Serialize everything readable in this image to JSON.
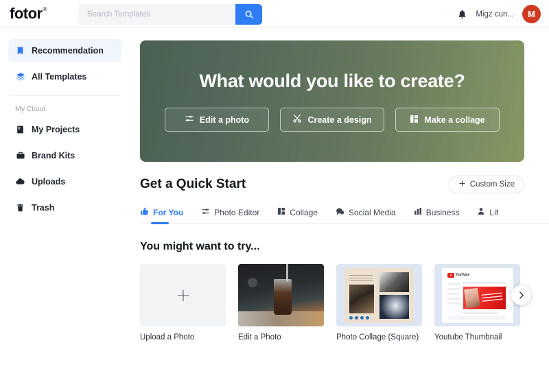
{
  "header": {
    "logo": "fotor",
    "logo_sup": "®",
    "search": {
      "value": "",
      "placeholder": "Search Templates",
      "icon": "search-icon"
    },
    "notification_icon": "bell-icon",
    "username": "Migz cun...",
    "avatar_initial": "M",
    "avatar_color": "#cf3a20",
    "accent_color": "#2f7df4"
  },
  "sidebar": {
    "items": [
      {
        "label": "Recommendation",
        "icon": "bookmark-icon",
        "active": true
      },
      {
        "label": "All Templates",
        "icon": "layers-icon",
        "active": false
      }
    ],
    "section_label": "My Cloud",
    "cloud_items": [
      {
        "label": "My Projects",
        "icon": "document-icon"
      },
      {
        "label": "Brand Kits",
        "icon": "briefcase-icon"
      },
      {
        "label": "Uploads",
        "icon": "cloud-upload-icon"
      },
      {
        "label": "Trash",
        "icon": "trash-icon"
      }
    ]
  },
  "hero": {
    "title": "What would you like to create?",
    "gradient_from": "#4a6152",
    "gradient_to": "#879661",
    "buttons": [
      {
        "label": "Edit a photo",
        "icon": "sliders-icon"
      },
      {
        "label": "Create a design",
        "icon": "scissors-icon"
      },
      {
        "label": "Make a collage",
        "icon": "collage-grid-icon"
      }
    ]
  },
  "quick_start": {
    "title": "Get a Quick Start",
    "custom_size_label": "Custom Size",
    "custom_size_icon": "plus-icon",
    "tabs": [
      {
        "label": "For You",
        "icon": "thumbs-up-icon",
        "active": true
      },
      {
        "label": "Photo Editor",
        "icon": "sliders-icon",
        "active": false
      },
      {
        "label": "Collage",
        "icon": "collage-grid-icon",
        "active": false
      },
      {
        "label": "Social Media",
        "icon": "chat-bubble-icon",
        "active": false
      },
      {
        "label": "Business",
        "icon": "bar-chart-icon",
        "active": false
      },
      {
        "label": "Lif",
        "icon": "person-icon",
        "active": false
      }
    ]
  },
  "try_section": {
    "title": "You might want to try...",
    "cards": [
      {
        "label": "Upload a Photo",
        "thumb": "plus-placeholder"
      },
      {
        "label": "Edit a Photo",
        "thumb": "coffee-photo"
      },
      {
        "label": "Photo Collage\n(Square)",
        "thumb": "collage-template"
      },
      {
        "label": "Youtube Thumbnail",
        "thumb": "youtube-template"
      }
    ],
    "next_icon": "chevron-right-icon"
  }
}
